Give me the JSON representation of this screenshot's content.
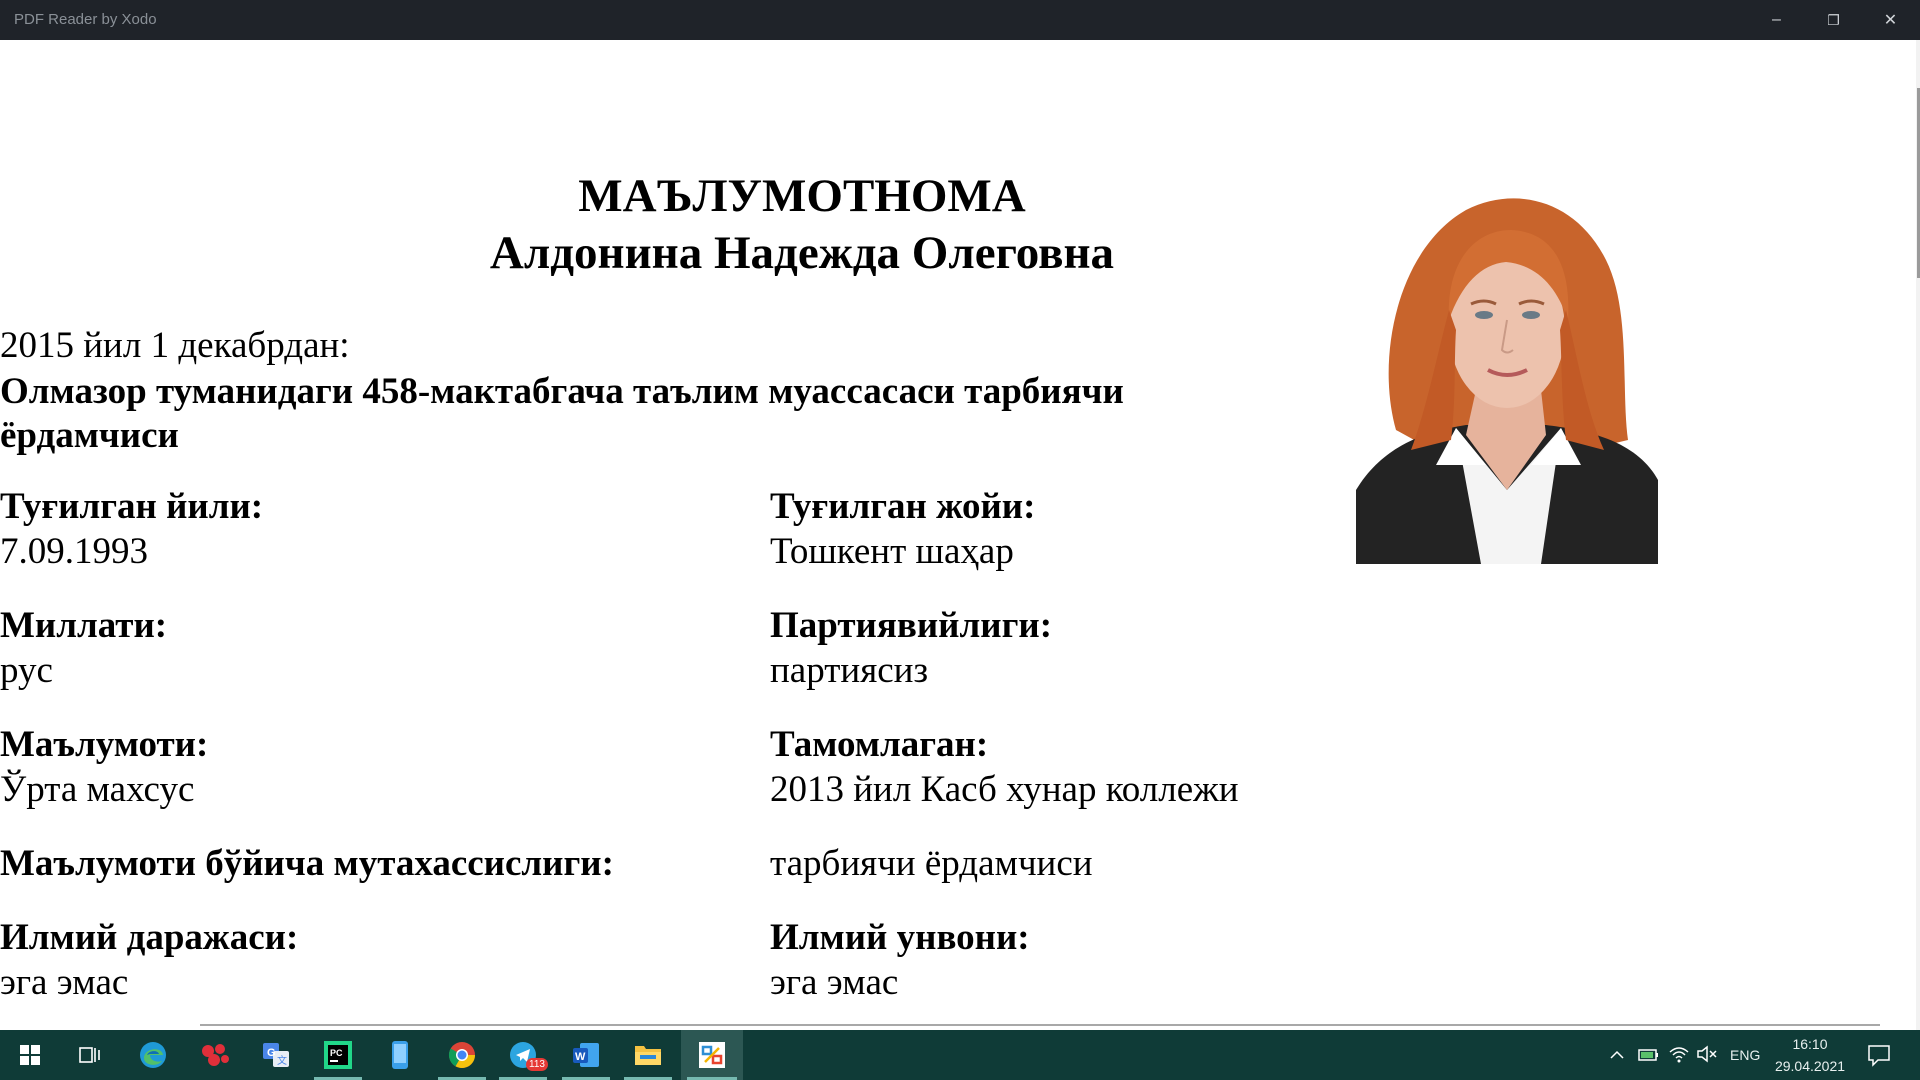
{
  "window": {
    "title": "PDF Reader by Xodo",
    "minimize_glyph": "–",
    "maximize_glyph": "❐",
    "close_glyph": "✕"
  },
  "document": {
    "heading": "МАЪЛУМОТНОМА",
    "name": "Алдонина Надежда Олеговна",
    "since_line": "2015 йил 1 декабрдан:",
    "position_line1": "Олмазор туманидаги 458-мактабгача таълим муассасаси тарбиячи",
    "position_line2": "ёрдамчиси",
    "fields": {
      "birth_year_label": "Туғилган йили:",
      "birth_year_value": "7.09.1993",
      "birth_place_label": "Туғилган жойи:",
      "birth_place_value": "Тошкент шаҳар",
      "nationality_label": "Миллати:",
      "nationality_value": "рус",
      "party_label": "Партиявийлиги:",
      "party_value": "партиясиз",
      "education_label": "Маълумоти:",
      "education_value": "Ўрта махсус",
      "graduated_label": "Тамомлаган:",
      "graduated_value": "2013 йил Касб хунар коллежи",
      "specialty_label": "Маълумоти бўйича мутахассислиги:",
      "specialty_value": "тарбиячи ёрдамчиси",
      "degree_label": "Илмий даражаси:",
      "degree_value": "эга эмас",
      "rank_label": "Илмий унвони:",
      "rank_value": "эга эмас"
    }
  },
  "taskbar": {
    "items": [
      {
        "name": "start-button",
        "icon": "windows-logo-icon"
      },
      {
        "name": "task-view-button",
        "icon": "task-view-icon"
      },
      {
        "name": "edge-button",
        "icon": "edge-icon"
      },
      {
        "name": "red-app-button",
        "icon": "molecule-icon"
      },
      {
        "name": "google-translate-button",
        "icon": "translate-icon"
      },
      {
        "name": "pycharm-button",
        "icon": "pycharm-icon"
      },
      {
        "name": "phone-app-button",
        "icon": "phone-icon"
      },
      {
        "name": "chrome-button",
        "icon": "chrome-icon"
      },
      {
        "name": "telegram-button",
        "icon": "telegram-icon"
      },
      {
        "name": "word-button",
        "icon": "word-icon"
      },
      {
        "name": "file-explorer-button",
        "icon": "folder-icon"
      },
      {
        "name": "xodo-button",
        "icon": "xodo-icon"
      }
    ],
    "telegram_badge": "113",
    "pycharm_label": "PC",
    "word_label": "W",
    "language": "ENG",
    "time": "16:10",
    "date": "29.04.2021",
    "colors": {
      "taskbar": "#0f3b37",
      "active": "#2c5753",
      "titlebar": "#1f2329"
    }
  }
}
